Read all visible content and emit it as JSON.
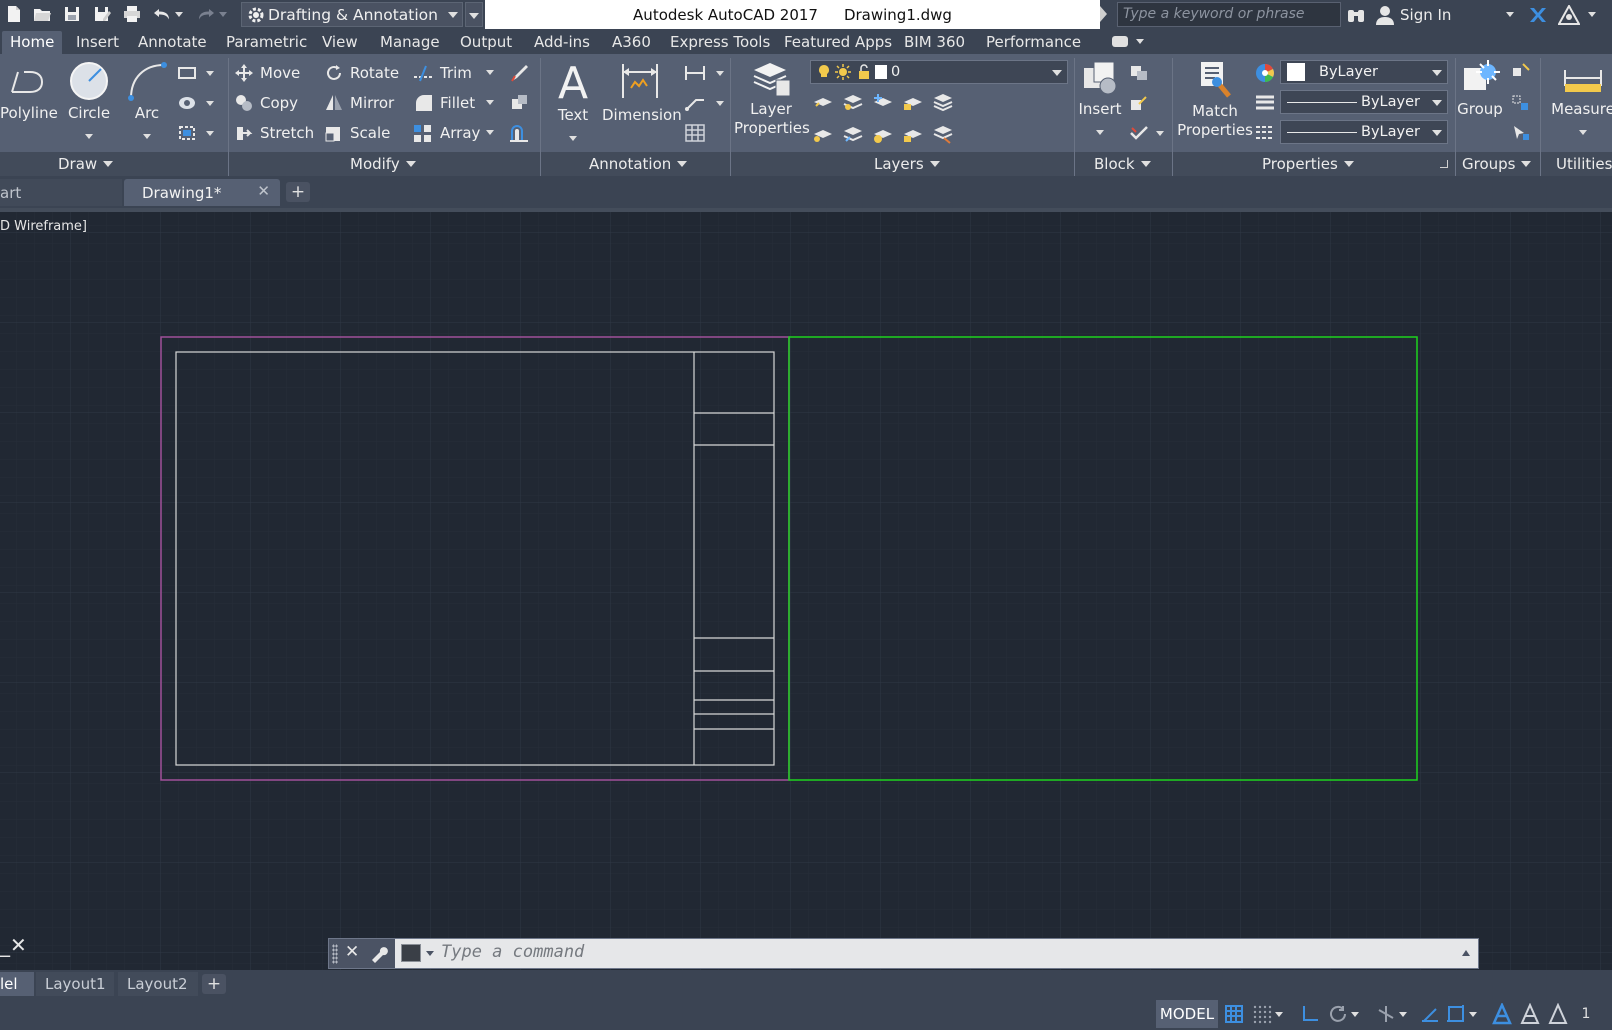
{
  "app": {
    "title": "Autodesk AutoCAD 2017",
    "filename": "Drawing1.dwg"
  },
  "workspace": {
    "name": "Drafting & Annotation"
  },
  "search": {
    "placeholder": "Type a keyword or phrase"
  },
  "account": {
    "sign_in": "Sign In"
  },
  "ribbon_tabs": [
    "Home",
    "Insert",
    "Annotate",
    "Parametric",
    "View",
    "Manage",
    "Output",
    "Add-ins",
    "A360",
    "Express Tools",
    "Featured Apps",
    "BIM 360",
    "Performance"
  ],
  "draw": {
    "polyline": "Polyline",
    "circle": "Circle",
    "arc": "Arc",
    "panel": "Draw"
  },
  "modify": {
    "move": "Move",
    "rotate": "Rotate",
    "trim": "Trim",
    "copy": "Copy",
    "mirror": "Mirror",
    "fillet": "Fillet",
    "stretch": "Stretch",
    "scale": "Scale",
    "array": "Array",
    "panel": "Modify"
  },
  "annotation": {
    "text": "Text",
    "dimension": "Dimension",
    "panel": "Annotation"
  },
  "layers": {
    "layer_properties_1": "Layer",
    "layer_properties_2": "Properties",
    "current_layer": "0",
    "panel": "Layers"
  },
  "block": {
    "insert": "Insert",
    "panel": "Block"
  },
  "properties": {
    "match_1": "Match",
    "match_2": "Properties",
    "color": "ByLayer",
    "linetype": "ByLayer",
    "lineweight": "ByLayer",
    "panel": "Properties"
  },
  "groups": {
    "group": "Group",
    "panel": "Groups"
  },
  "utilities": {
    "measure": "Measure",
    "panel": "Utilities"
  },
  "file_tabs": {
    "start": "art",
    "drawing": "Drawing1*"
  },
  "viewport": {
    "label": "D Wireframe]"
  },
  "command": {
    "placeholder": "Type a command"
  },
  "layout_tabs": [
    "lel",
    "Layout1",
    "Layout2"
  ],
  "status": {
    "model": "MODEL"
  },
  "colors": {
    "canvas": "#212833",
    "grid_minor": "#262e39",
    "grid_major": "#2e3744",
    "magenta_frame": "#a0509a",
    "green_frame": "#1ed21e",
    "white_lines": "#d8d8d8",
    "accent_blue": "#3d8fe0"
  }
}
